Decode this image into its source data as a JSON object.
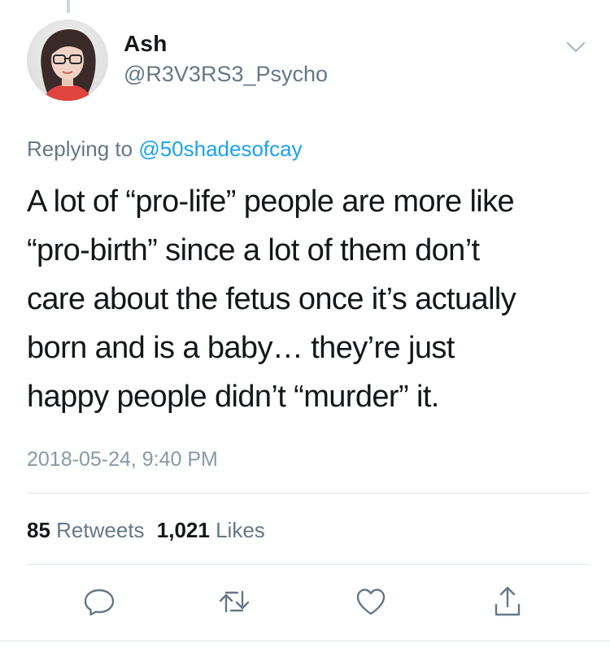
{
  "user": {
    "name": "Ash",
    "handle": "@R3V3RS3_Psycho"
  },
  "reply": {
    "prefix": "Replying to ",
    "to_handle": "@50shadesofcay"
  },
  "tweet": {
    "lines": [
      "A lot of “pro-life” people are more like",
      "“pro-birth” since a lot of them don’t",
      "care about the fetus once it’s actually",
      "born and is a baby… they’re just",
      "happy people didn’t “murder” it."
    ],
    "timestamp": "2018-05-24, 9:40 PM"
  },
  "stats": {
    "retweets_count": "85",
    "retweets_label": "Retweets",
    "likes_count": "1,021",
    "likes_label": "Likes"
  },
  "icons": {
    "chevron": "chevron-down-icon",
    "reply": "reply-icon",
    "retweet": "retweet-icon",
    "like": "heart-icon",
    "share": "share-icon"
  },
  "colors": {
    "text": "#14171a",
    "secondary": "#657786",
    "link": "#1da1f2",
    "divider": "#e1e8ed",
    "icon": "#657786"
  }
}
